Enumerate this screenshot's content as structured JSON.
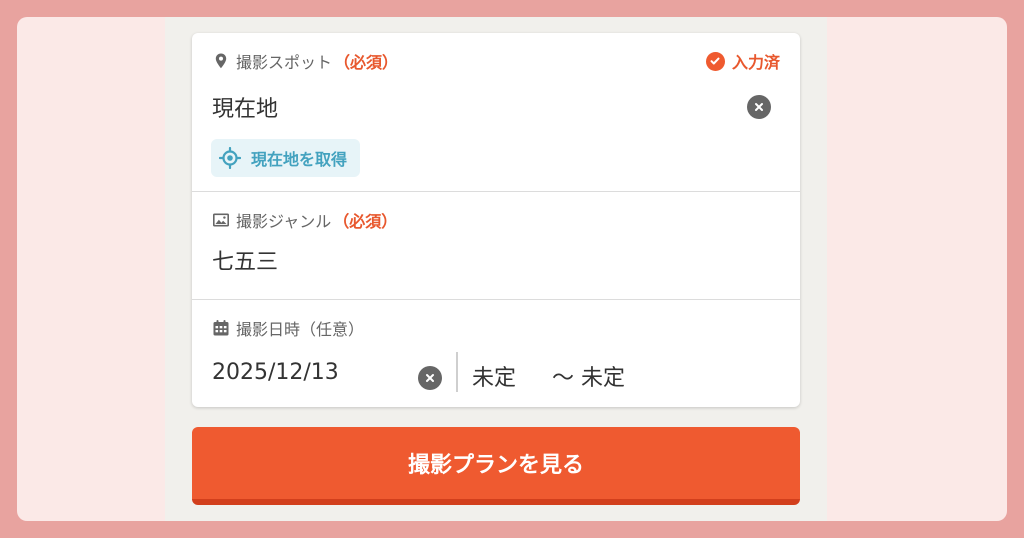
{
  "spot": {
    "label": "撮影スポット",
    "required": "（必須）",
    "status": "入力済",
    "value": "現在地",
    "geo_button": "現在地を取得",
    "icon": "map-pin-icon"
  },
  "genre": {
    "label": "撮影ジャンル",
    "required": "（必須）",
    "value": "七五三",
    "icon": "image-icon"
  },
  "datetime": {
    "label": "撮影日時（任意）",
    "date_value": "2025/12/13",
    "time_from": "未定",
    "time_to": "～ 未定",
    "icon": "calendar-icon"
  },
  "submit_label": "撮影プランを見る",
  "colors": {
    "accent": "#ef5a30",
    "accent_dark": "#d23f1c",
    "link": "#43a2bf",
    "outer_bg": "#e8a39f",
    "panel_bg": "#fbe9e7"
  }
}
